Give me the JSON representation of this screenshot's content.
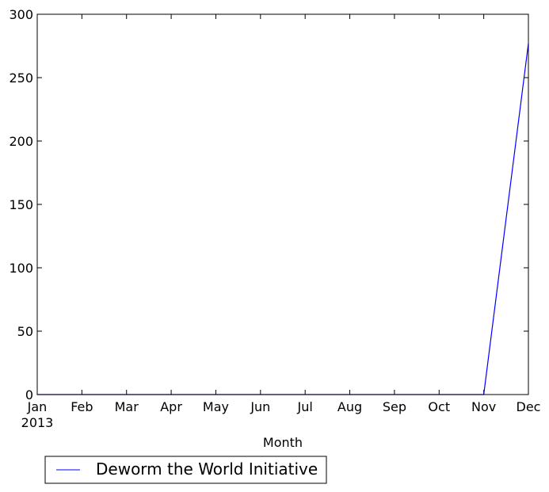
{
  "chart_data": {
    "type": "line",
    "title": "",
    "xlabel": "Month",
    "ylabel": "",
    "categories": [
      "Jan",
      "Feb",
      "Mar",
      "Apr",
      "May",
      "Jun",
      "Jul",
      "Aug",
      "Sep",
      "Oct",
      "Nov",
      "Dec"
    ],
    "x_sublabel": "2013",
    "series": [
      {
        "name": "Deworm the World Initiative",
        "color": "#0000ff",
        "values": [
          0,
          0,
          0,
          0,
          0,
          0,
          0,
          0,
          0,
          0,
          0,
          277
        ]
      }
    ],
    "ylim": [
      0,
      300
    ],
    "yticks": [
      0,
      50,
      100,
      150,
      200,
      250,
      300
    ],
    "grid": false,
    "legend": "bottom-left"
  }
}
